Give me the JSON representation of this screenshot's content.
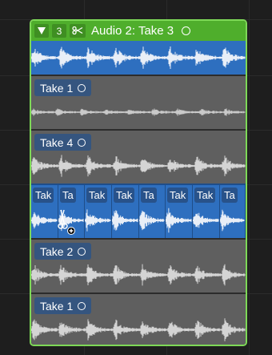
{
  "folder": {
    "header": {
      "disclosure_icon": "triangle-down-icon",
      "take_count": "3",
      "scissors_icon": "scissors-icon",
      "title": "Audio 2: Take 3",
      "status_icon": "circle-icon"
    },
    "takes": [
      {
        "label": "Take 1"
      },
      {
        "label": "Take 4"
      },
      {
        "label": "Take 2"
      },
      {
        "label": "Take 1"
      }
    ],
    "comp_segments": [
      "Tak",
      "Ta",
      "Tak",
      "Tak",
      "Ta",
      "Tak",
      "Tak",
      "Ta"
    ]
  },
  "colors": {
    "folder_border": "#7ed957",
    "header_bg": "#4fae2c",
    "comp_blue": "#2e6fbf",
    "take_gray": "#5f5f5f",
    "wave_light": "#d8d8d8"
  },
  "cursor_icon": "scissors-add-cursor-icon"
}
